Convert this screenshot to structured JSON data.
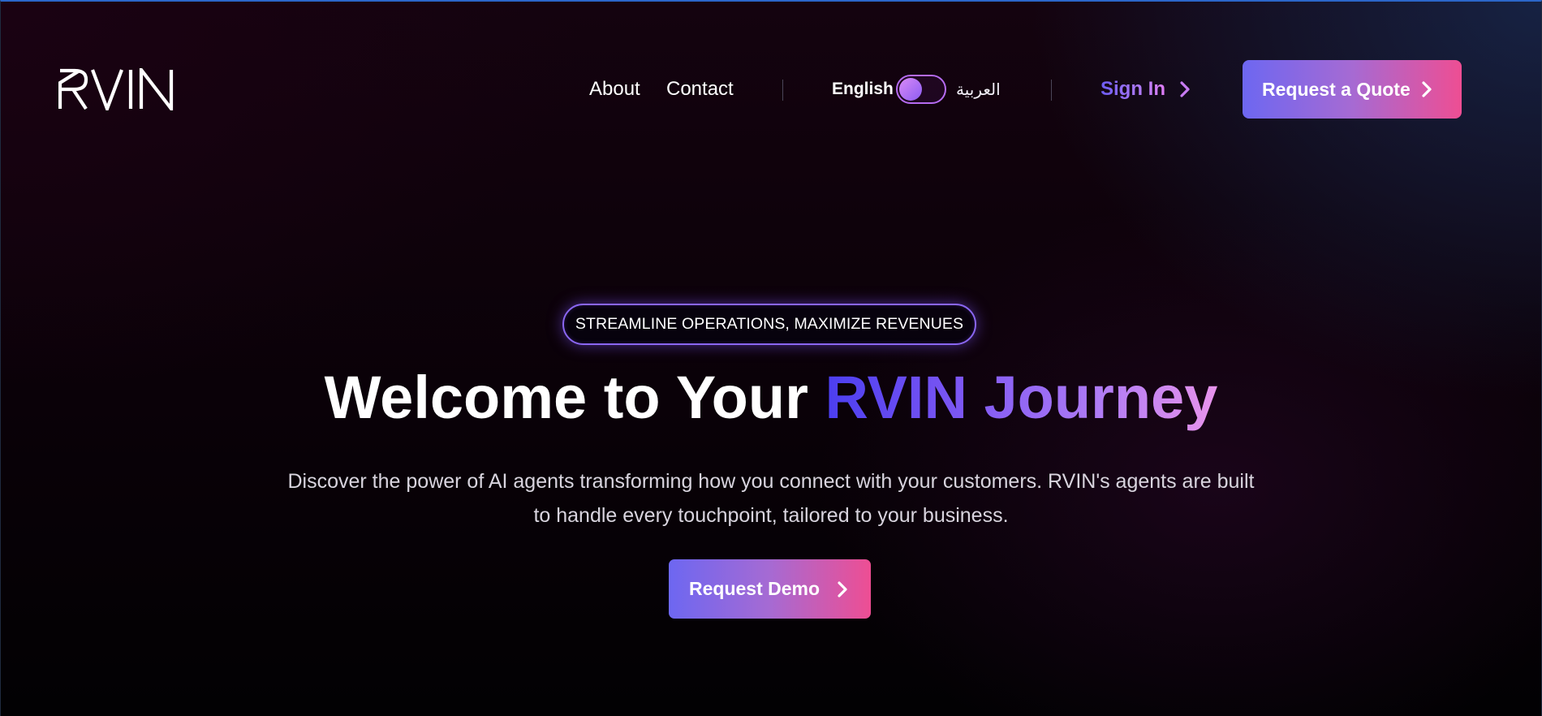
{
  "header": {
    "logo_text": "RVIN",
    "nav": {
      "about_label": "About",
      "contact_label": "Contact"
    },
    "language": {
      "english_label": "English",
      "arabic_label": "العربية",
      "selected": "English"
    },
    "signin_label": "Sign In",
    "quote_button_label": "Request a Quote"
  },
  "hero": {
    "badge_text": "STREAMLINE OPERATIONS, MAXIMIZE REVENUES",
    "title_plain": "Welcome to Your ",
    "title_accent": "RVIN Journey",
    "description": "Discover the power of AI agents transforming how you connect with your customers. RVIN's agents are built to handle every touchpoint, tailored to your business.",
    "demo_button_label": "Request Demo"
  },
  "icons": {
    "signin": "chevron-right-icon",
    "quote": "chevron-right-icon",
    "demo": "chevron-right-icon"
  },
  "colors": {
    "accent_start": "#6d67f1",
    "accent_end": "#ee4e93",
    "title_gradient_start": "#4b3ef0",
    "title_gradient_end": "#e894ec",
    "background_dark": "#0a0108"
  }
}
